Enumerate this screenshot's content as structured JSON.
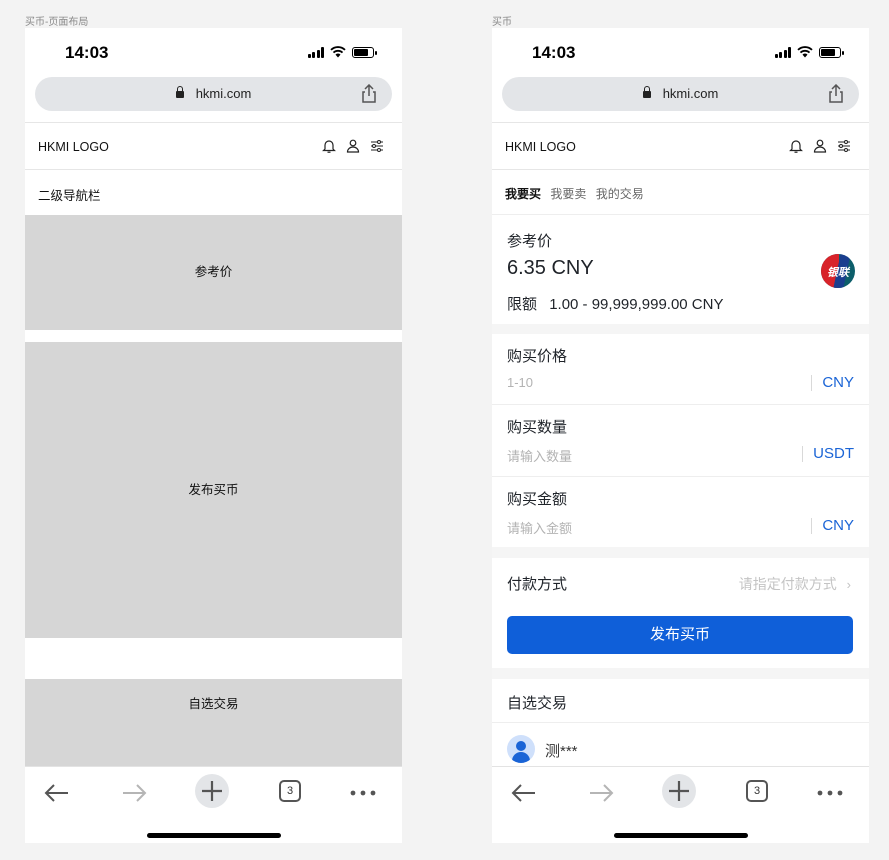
{
  "frames": [
    {
      "title": "买币-页面布局"
    },
    {
      "title": "买币"
    }
  ],
  "status_bar": {
    "time": "14:03"
  },
  "browser": {
    "url": "hkmi.com",
    "tab_count": "3"
  },
  "header": {
    "logo": "HKMI LOGO",
    "icons": [
      "bell-icon",
      "user-icon",
      "settings-sliders-icon"
    ]
  },
  "wireframe": {
    "subnav": "二级导航栏",
    "blocks": [
      "参考价",
      "发布买币",
      "自选交易"
    ]
  },
  "buy": {
    "tabs": [
      "我要买",
      "我要卖",
      "我的交易"
    ],
    "active_tab": "我要买",
    "reference": {
      "title": "参考价",
      "price": "6.35 CNY",
      "limit_label": "限额",
      "limit_value": "1.00 - 99,999,999.00 CNY",
      "badge_text": "银联"
    },
    "form": [
      {
        "label": "购买价格",
        "placeholder": "1-10",
        "unit": "CNY"
      },
      {
        "label": "购买数量",
        "placeholder": "请输入数量",
        "unit": "USDT"
      },
      {
        "label": "购买金额",
        "placeholder": "请输入金额",
        "unit": "CNY"
      }
    ],
    "payment": {
      "label": "付款方式",
      "placeholder": "请指定付款方式"
    },
    "submit_label": "发布买币",
    "selected": {
      "title": "自选交易",
      "user": "测***"
    }
  },
  "colors": {
    "primary": "#0f5fd9",
    "placeholder_block": "#d6d6d6",
    "unionpay_red": "#d8232a"
  }
}
